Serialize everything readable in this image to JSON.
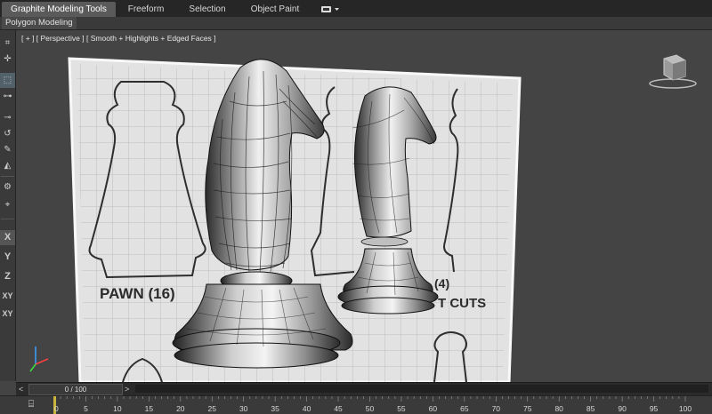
{
  "ribbon": {
    "tabs": [
      {
        "label": "Graphite Modeling Tools",
        "active": true
      },
      {
        "label": "Freeform",
        "active": false
      },
      {
        "label": "Selection",
        "active": false
      },
      {
        "label": "Object Paint",
        "active": false
      }
    ],
    "extra_icon": "toggle-panel-icon",
    "sub_tab": "Polygon Modeling"
  },
  "left_toolbar": {
    "tools": [
      "grid-snap-icon",
      "move-icon",
      "select-icon",
      "align-icon",
      "spacing-icon",
      "rotate-icon",
      "paint-icon",
      "shape-icon",
      "hierarchy-icon",
      "pivot-icon"
    ],
    "axes": [
      "X",
      "Y",
      "Z",
      "XY",
      "XY"
    ]
  },
  "viewport": {
    "label": "[ + ] [ Perspective ] [ Smooth + Highlights + Edged Faces ]",
    "blueprint": {
      "text_pawn": "PAWN (16)",
      "text_cuts": "T CUTS",
      "text_count": "(4)"
    },
    "colors": {
      "background": "#444444",
      "paper": "#e4e4e4",
      "model": "#d0d0d0",
      "wire": "#1a1a1a"
    }
  },
  "timeline": {
    "current": "0 / 100",
    "ticks": [
      "0",
      "5",
      "10",
      "15",
      "20",
      "25",
      "30",
      "35",
      "40",
      "45",
      "50",
      "55",
      "60",
      "65",
      "70",
      "75",
      "80",
      "85",
      "90",
      "95",
      "100"
    ]
  }
}
